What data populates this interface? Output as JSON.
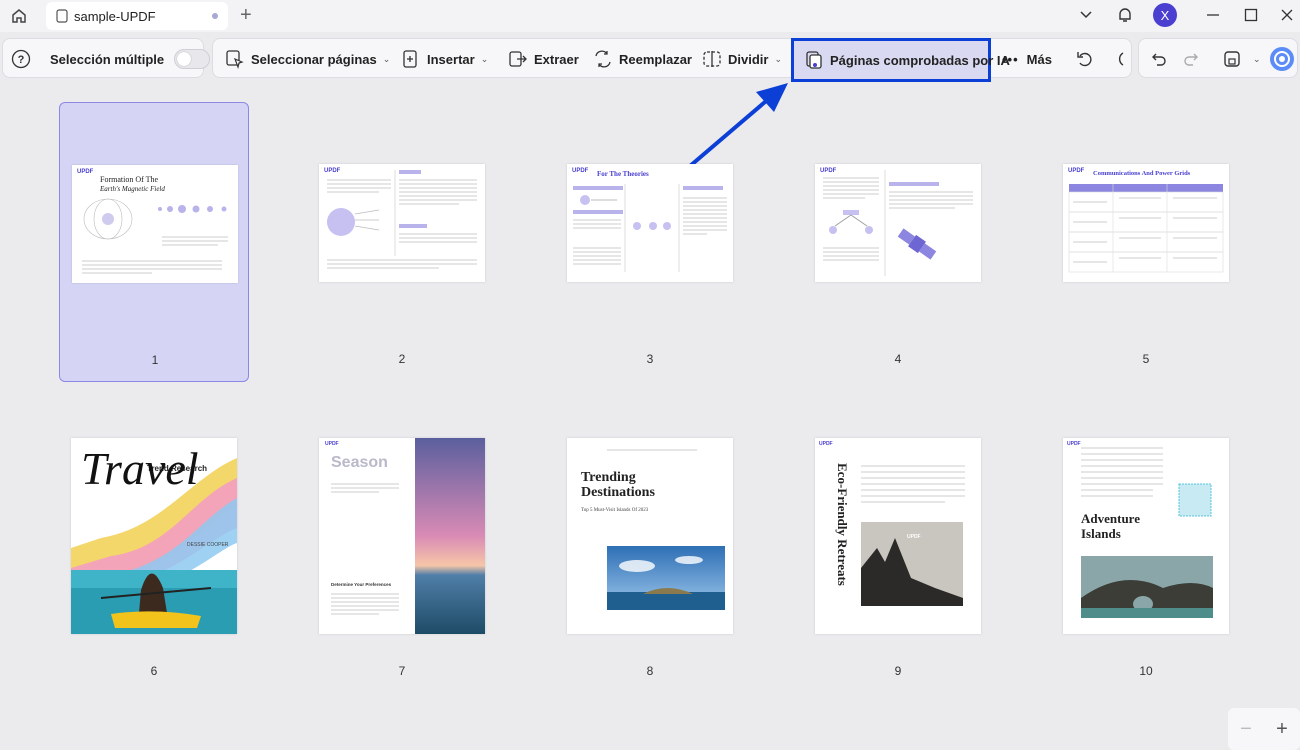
{
  "titlebar": {
    "tab_title": "sample-UPDF",
    "avatar_letter": "X"
  },
  "toolbar": {
    "multi_select_label": "Selección múltiple",
    "select_pages_label": "Seleccionar páginas",
    "insert_label": "Insertar",
    "extract_label": "Extraer",
    "replace_label": "Reemplazar",
    "split_label": "Dividir",
    "ai_pages_label": "Páginas comprobadas por IA",
    "more_label": "Más"
  },
  "pages": [
    "1",
    "2",
    "3",
    "4",
    "5",
    "6",
    "7",
    "8",
    "9",
    "10"
  ],
  "thumb_text": {
    "p1_title_a": "Formation Of The",
    "p1_title_b": "Earth's Magnetic Field",
    "p3_title": "For The Theories",
    "p5_title": "Communications And Power Grids",
    "p6_title": "Travel",
    "p6_sub": "Trend Research",
    "p6_author": "DESSIE COOPER",
    "p7_title": "Season",
    "p7_sub": "Determine Your Preferences",
    "p8_title_a": "Trending",
    "p8_title_b": "Destinations",
    "p8_sub": "Top 5 Must-Visit Islands Of 2023",
    "p9_title": "Eco-Friendly Retreats",
    "p10_title_a": "Adventure",
    "p10_title_b": "Islands",
    "logo": "UPDF"
  },
  "colors": {
    "accent": "#4a3fd0",
    "highlight_border": "#0b3fd6",
    "selection": "#d5d4f5"
  },
  "zoom": {
    "minus": "−",
    "plus": "+"
  }
}
